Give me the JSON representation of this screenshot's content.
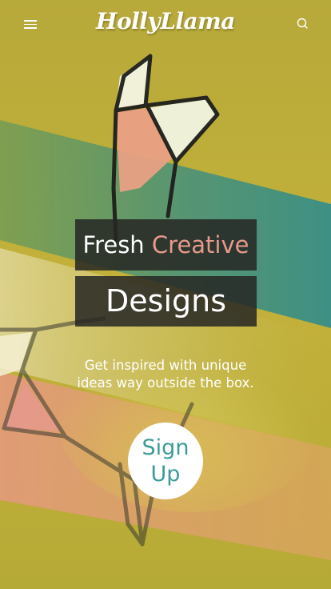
{
  "header": {
    "logo_text": "HollyLlama",
    "menu_icon": "hamburger-menu-icon",
    "search_icon": "search-icon"
  },
  "hero": {
    "title_word1": "Fresh",
    "title_word2": "Creative",
    "title_line2": "Designs",
    "tagline_line1": "Get inspired with unique",
    "tagline_line2": "ideas way outside the box.",
    "signup_line1": "Sign",
    "signup_line2": "Up"
  },
  "colors": {
    "background": "#b9ab37",
    "accent_pink": "#e8998a",
    "accent_teal": "#3b9b98",
    "box_dark": "#262624"
  }
}
